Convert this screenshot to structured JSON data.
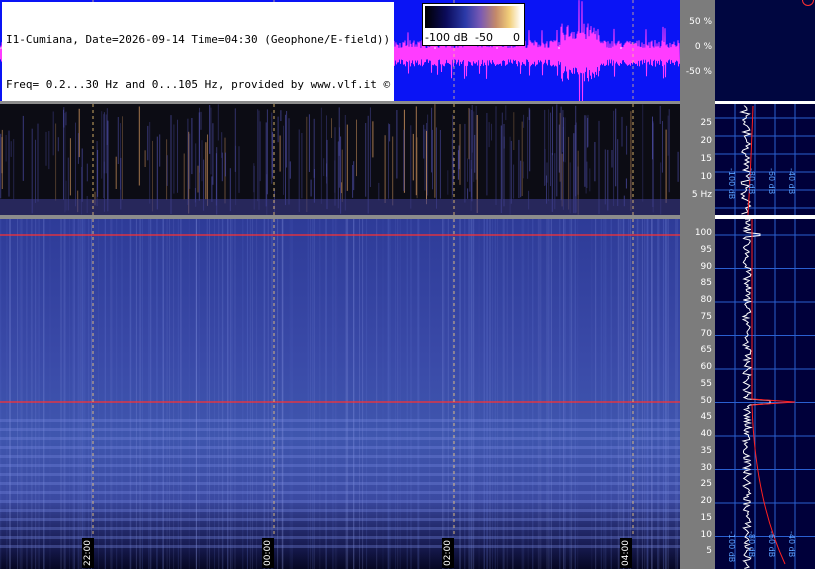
{
  "header": {
    "line1": "I1-Cumiana, Date=2026-09-14 Time=04:30 (Geophone/E-field))",
    "line2": "Freq= 0.2...30 Hz and 0...105 Hz, provided by www.vlf.it ©"
  },
  "colorbar": {
    "min_label": "-100 dB",
    "mid_label": "-50",
    "max_label": "0"
  },
  "amplitude_axis": [
    "50 %",
    "0 %",
    "-50 %"
  ],
  "low_freq_axis": [
    "25",
    "20",
    "15",
    "10",
    "5 Hz"
  ],
  "main_freq_axis": [
    "100",
    "95",
    "90",
    "85",
    "80",
    "75",
    "70",
    "65",
    "60",
    "55",
    "50",
    "45",
    "40",
    "35",
    "30",
    "25",
    "20",
    "15",
    "10",
    "5"
  ],
  "time_labels": [
    "22:00",
    "00:00",
    "02:00",
    "04:00"
  ],
  "db_labels_low": [
    "-100 dB",
    "-80 dB",
    "-60 dB",
    "-40 dB",
    "-20 dB"
  ],
  "db_labels_main": [
    "-100 dB",
    "-80 dB",
    "-60 dB",
    "-40 dB",
    "-20 dB"
  ],
  "colors": {
    "waveform_bg": "#0a14f5",
    "waveform_trace": "#ff3cff",
    "spectrum_trace": "#ffffff",
    "fit_curve": "#ff2020",
    "mains_line": "#ff3030",
    "time_marker": "#ffd27a",
    "panel_grid": "#2a5fd0"
  },
  "icons": {
    "title_copyright": "copyright-symbol",
    "top_right_corner": "circle-indicator"
  }
}
